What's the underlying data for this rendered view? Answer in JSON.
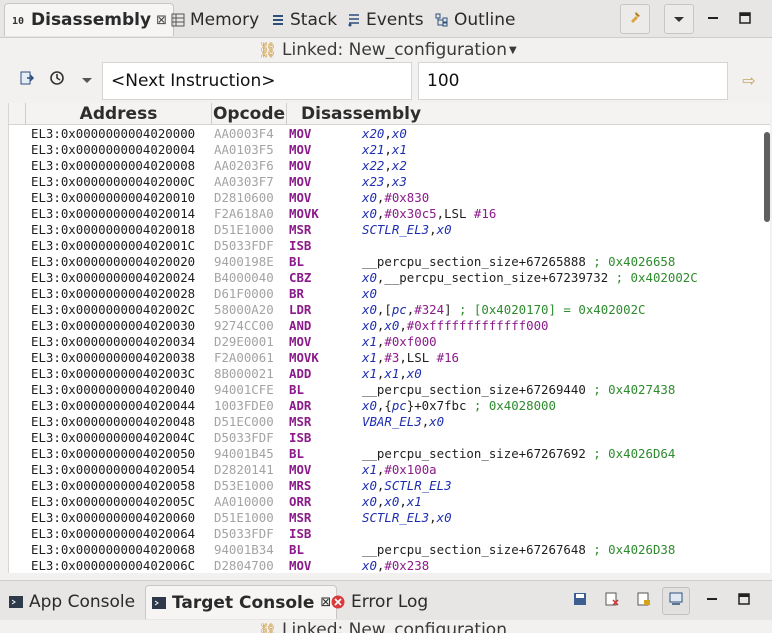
{
  "tabs": [
    {
      "label": "Disassembly",
      "icon": "disassembly-icon",
      "active": true,
      "close": "⊠"
    },
    {
      "label": "Memory",
      "icon": "memory-icon"
    },
    {
      "label": "Stack",
      "icon": "stack-icon"
    },
    {
      "label": "Events",
      "icon": "events-icon"
    },
    {
      "label": "Outline",
      "icon": "outline-icon"
    }
  ],
  "linked_label": "Linked: New_configuration",
  "toolbar": {
    "address_value": "<Next Instruction>",
    "count_value": "100"
  },
  "columns": {
    "address": "Address",
    "opcode": "Opcode",
    "disassembly": "Disassembly"
  },
  "rows": [
    {
      "addr": "EL3:0x0000000004020000",
      "op": "AA0003F4",
      "mn": "MOV",
      "ops": [
        [
          "r",
          "x20"
        ],
        [
          "t",
          ","
        ],
        [
          "r",
          "x0"
        ]
      ]
    },
    {
      "addr": "EL3:0x0000000004020004",
      "op": "AA0103F5",
      "mn": "MOV",
      "ops": [
        [
          "r",
          "x21"
        ],
        [
          "t",
          ","
        ],
        [
          "r",
          "x1"
        ]
      ]
    },
    {
      "addr": "EL3:0x0000000004020008",
      "op": "AA0203F6",
      "mn": "MOV",
      "ops": [
        [
          "r",
          "x22"
        ],
        [
          "t",
          ","
        ],
        [
          "r",
          "x2"
        ]
      ]
    },
    {
      "addr": "EL3:0x000000000402000C",
      "op": "AA0303F7",
      "mn": "MOV",
      "ops": [
        [
          "r",
          "x23"
        ],
        [
          "t",
          ","
        ],
        [
          "r",
          "x3"
        ]
      ]
    },
    {
      "addr": "EL3:0x0000000004020010",
      "op": "D2810600",
      "mn": "MOV",
      "ops": [
        [
          "r",
          "x0"
        ],
        [
          "t",
          ","
        ],
        [
          "i",
          "#0x830"
        ]
      ]
    },
    {
      "addr": "EL3:0x0000000004020014",
      "op": "F2A618A0",
      "mn": "MOVK",
      "ops": [
        [
          "r",
          "x0"
        ],
        [
          "t",
          ","
        ],
        [
          "i",
          "#0x30c5"
        ],
        [
          "t",
          ",LSL "
        ],
        [
          "i",
          "#16"
        ]
      ]
    },
    {
      "addr": "EL3:0x0000000004020018",
      "op": "D51E1000",
      "mn": "MSR",
      "ops": [
        [
          "r",
          "SCTLR_EL3"
        ],
        [
          "t",
          ","
        ],
        [
          "r",
          "x0"
        ]
      ]
    },
    {
      "addr": "EL3:0x000000000402001C",
      "op": "D5033FDF",
      "mn": "ISB",
      "ops": []
    },
    {
      "addr": "EL3:0x0000000004020020",
      "op": "9400198E",
      "mn": "BL",
      "ops": [
        [
          "t",
          "__percpu_section_size+67265888 "
        ],
        [
          "c",
          "; 0x4026658"
        ]
      ]
    },
    {
      "addr": "EL3:0x0000000004020024",
      "op": "B4000040",
      "mn": "CBZ",
      "ops": [
        [
          "r",
          "x0"
        ],
        [
          "t",
          ",__percpu_section_size+67239732 "
        ],
        [
          "c",
          "; 0x402002C"
        ]
      ]
    },
    {
      "addr": "EL3:0x0000000004020028",
      "op": "D61F0000",
      "mn": "BR",
      "ops": [
        [
          "r",
          "x0"
        ]
      ]
    },
    {
      "addr": "EL3:0x000000000402002C",
      "op": "58000A20",
      "mn": "LDR",
      "ops": [
        [
          "r",
          "x0"
        ],
        [
          "t",
          ",["
        ],
        [
          "r",
          "pc"
        ],
        [
          "t",
          ","
        ],
        [
          "i",
          "#324"
        ],
        [
          "t",
          "] "
        ],
        [
          "c",
          "; [0x4020170] = 0x402002C"
        ]
      ]
    },
    {
      "addr": "EL3:0x0000000004020030",
      "op": "9274CC00",
      "mn": "AND",
      "ops": [
        [
          "r",
          "x0"
        ],
        [
          "t",
          ","
        ],
        [
          "r",
          "x0"
        ],
        [
          "t",
          ","
        ],
        [
          "i",
          "#0xfffffffffffff000"
        ]
      ]
    },
    {
      "addr": "EL3:0x0000000004020034",
      "op": "D29E0001",
      "mn": "MOV",
      "ops": [
        [
          "r",
          "x1"
        ],
        [
          "t",
          ","
        ],
        [
          "i",
          "#0xf000"
        ]
      ]
    },
    {
      "addr": "EL3:0x0000000004020038",
      "op": "F2A00061",
      "mn": "MOVK",
      "ops": [
        [
          "r",
          "x1"
        ],
        [
          "t",
          ","
        ],
        [
          "i",
          "#3"
        ],
        [
          "t",
          ",LSL "
        ],
        [
          "i",
          "#16"
        ]
      ]
    },
    {
      "addr": "EL3:0x000000000402003C",
      "op": "8B000021",
      "mn": "ADD",
      "ops": [
        [
          "r",
          "x1"
        ],
        [
          "t",
          ","
        ],
        [
          "r",
          "x1"
        ],
        [
          "t",
          ","
        ],
        [
          "r",
          "x0"
        ]
      ]
    },
    {
      "addr": "EL3:0x0000000004020040",
      "op": "94001CFE",
      "mn": "BL",
      "ops": [
        [
          "t",
          "__percpu_section_size+67269440 "
        ],
        [
          "c",
          "; 0x4027438"
        ]
      ]
    },
    {
      "addr": "EL3:0x0000000004020044",
      "op": "1003FDE0",
      "mn": "ADR",
      "ops": [
        [
          "r",
          "x0"
        ],
        [
          "t",
          ",{"
        ],
        [
          "r",
          "pc"
        ],
        [
          "t",
          "}+0x7fbc "
        ],
        [
          "c",
          "; 0x4028000"
        ]
      ]
    },
    {
      "addr": "EL3:0x0000000004020048",
      "op": "D51EC000",
      "mn": "MSR",
      "ops": [
        [
          "r",
          "VBAR_EL3"
        ],
        [
          "t",
          ","
        ],
        [
          "r",
          "x0"
        ]
      ]
    },
    {
      "addr": "EL3:0x000000000402004C",
      "op": "D5033FDF",
      "mn": "ISB",
      "ops": []
    },
    {
      "addr": "EL3:0x0000000004020050",
      "op": "94001B45",
      "mn": "BL",
      "ops": [
        [
          "t",
          "__percpu_section_size+67267692 "
        ],
        [
          "c",
          "; 0x4026D64"
        ]
      ]
    },
    {
      "addr": "EL3:0x0000000004020054",
      "op": "D2820141",
      "mn": "MOV",
      "ops": [
        [
          "r",
          "x1"
        ],
        [
          "t",
          ","
        ],
        [
          "i",
          "#0x100a"
        ]
      ]
    },
    {
      "addr": "EL3:0x0000000004020058",
      "op": "D53E1000",
      "mn": "MRS",
      "ops": [
        [
          "r",
          "x0"
        ],
        [
          "t",
          ","
        ],
        [
          "r",
          "SCTLR_EL3"
        ]
      ]
    },
    {
      "addr": "EL3:0x000000000402005C",
      "op": "AA010000",
      "mn": "ORR",
      "ops": [
        [
          "r",
          "x0"
        ],
        [
          "t",
          ","
        ],
        [
          "r",
          "x0"
        ],
        [
          "t",
          ","
        ],
        [
          "r",
          "x1"
        ]
      ]
    },
    {
      "addr": "EL3:0x0000000004020060",
      "op": "D51E1000",
      "mn": "MSR",
      "ops": [
        [
          "r",
          "SCTLR_EL3"
        ],
        [
          "t",
          ","
        ],
        [
          "r",
          "x0"
        ]
      ]
    },
    {
      "addr": "EL3:0x0000000004020064",
      "op": "D5033FDF",
      "mn": "ISB",
      "ops": []
    },
    {
      "addr": "EL3:0x0000000004020068",
      "op": "94001B34",
      "mn": "BL",
      "ops": [
        [
          "t",
          "__percpu_section_size+67267648 "
        ],
        [
          "c",
          "; 0x4026D38"
        ]
      ]
    },
    {
      "addr": "EL3:0x000000000402006C",
      "op": "D2804700",
      "mn": "MOV",
      "ops": [
        [
          "r",
          "x0"
        ],
        [
          "t",
          ","
        ],
        [
          "i",
          "#0x238"
        ]
      ]
    }
  ],
  "bottom_tabs": [
    {
      "label": "App Console",
      "icon": "console-icon"
    },
    {
      "label": "Target Console",
      "icon": "console-icon",
      "active": true,
      "close": "⊠"
    },
    {
      "label": "Error Log",
      "icon": "error-log-icon"
    }
  ],
  "bottom_linked_label": "Linked: New_configuration",
  "colors": {
    "mnemonic": "#8b1a8b",
    "register": "#1d2db0",
    "comment": "#2e8b2e",
    "opcode": "#a3a3a3"
  }
}
